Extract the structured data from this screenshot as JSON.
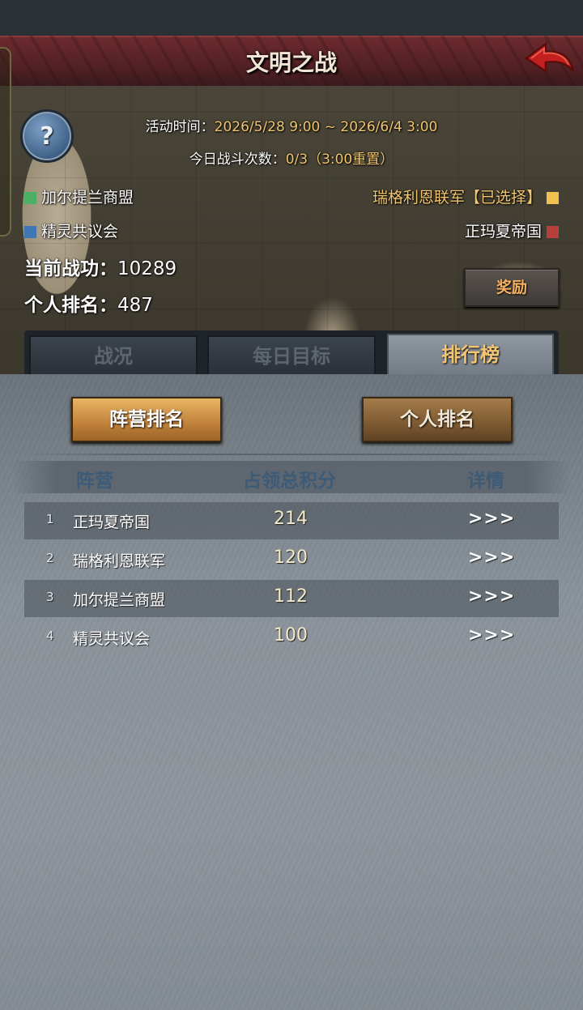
{
  "header": {
    "title": "文明之战"
  },
  "event": {
    "time_label": "活动时间：",
    "time_value": "2026/5/28 9:00 ~ 2026/6/4 3:00",
    "daily_label": "今日战斗次数：",
    "daily_value": "0/3（3:00重置）"
  },
  "factions": [
    {
      "name": "加尔提兰商盟",
      "color": "#4bb064"
    },
    {
      "name": "瑞格利恩联军【已选择】",
      "color": "#f0c050"
    },
    {
      "name": "精灵共议会",
      "color": "#3f76b4"
    },
    {
      "name": "正玛夏帝国",
      "color": "#b8403c"
    }
  ],
  "stats": {
    "merit_label": "当前战功：",
    "merit_value": "10289",
    "rank_label": "个人排名：",
    "rank_value": "487"
  },
  "reward_button": "奖励",
  "tabs": [
    {
      "label": "战况",
      "active": false
    },
    {
      "label": "每日目标",
      "active": false
    },
    {
      "label": "排行榜",
      "active": true
    }
  ],
  "sub_tabs": {
    "faction_rank": "阵营排名",
    "personal_rank": "个人排名"
  },
  "table": {
    "headers": {
      "faction": "阵营",
      "score": "占领总积分",
      "detail": "详情"
    },
    "rows": [
      {
        "rank": "1",
        "faction": "正玛夏帝国",
        "score": "214",
        "detail": ">>>"
      },
      {
        "rank": "2",
        "faction": "瑞格利恩联军",
        "score": "120",
        "detail": ">>>"
      },
      {
        "rank": "3",
        "faction": "加尔提兰商盟",
        "score": "112",
        "detail": ">>>"
      },
      {
        "rank": "4",
        "faction": "精灵共议会",
        "score": "100",
        "detail": ">>>"
      }
    ]
  },
  "icons": {
    "help": "?",
    "back": "back-arrow-icon"
  }
}
